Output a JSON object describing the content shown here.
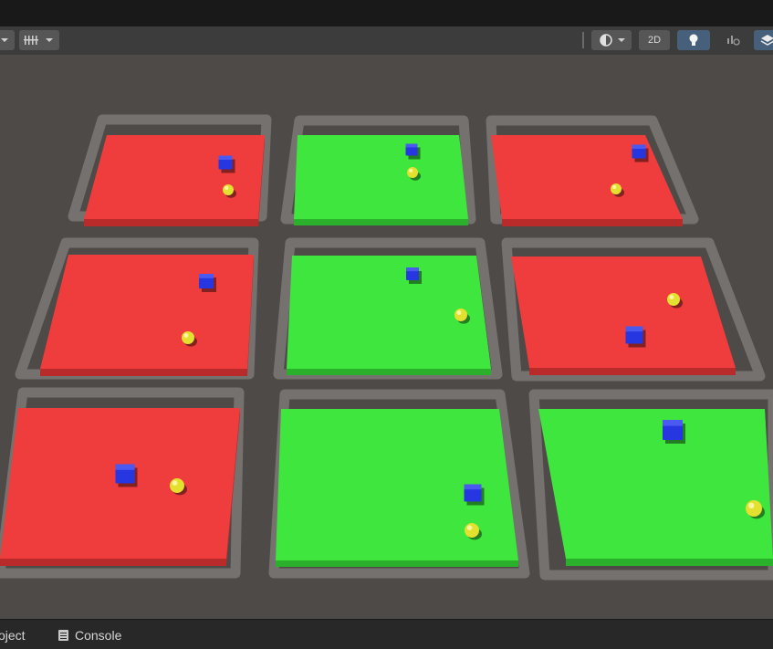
{
  "toolbar": {
    "mode_2d_label": "2D",
    "icons": [
      "gizmo-grid-icon",
      "shading-mode-icon",
      "lighting-icon",
      "audio-effects-icon",
      "layers-icon"
    ]
  },
  "scene": {
    "colors": {
      "background": "#4e4a47",
      "red_top": "#ef3d3d",
      "red_side": "#b92b2b",
      "green_top": "#3ee63e",
      "green_side": "#2bb02b",
      "agent_blue": "#2636e0",
      "target_yellow": "#e4e030"
    },
    "areas": [
      {
        "state": "red"
      },
      {
        "state": "green"
      },
      {
        "state": "red"
      },
      {
        "state": "red"
      },
      {
        "state": "green"
      },
      {
        "state": "red"
      },
      {
        "state": "red"
      },
      {
        "state": "green"
      },
      {
        "state": "green"
      }
    ]
  },
  "bottom_tabs": {
    "project_label": "oject",
    "console_label": "Console"
  }
}
